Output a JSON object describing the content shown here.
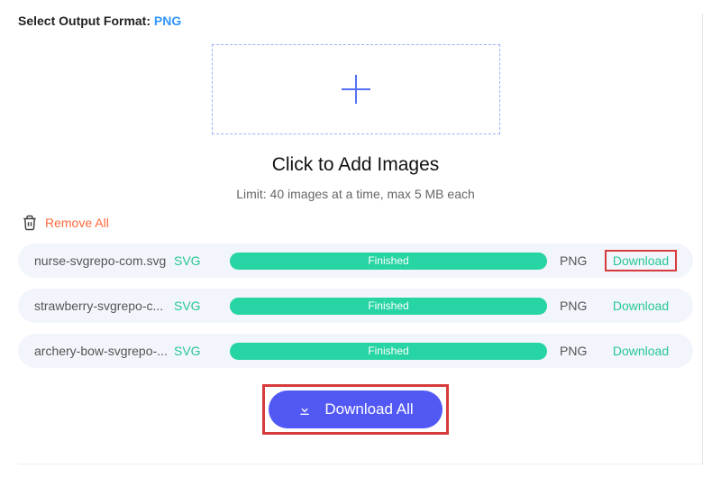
{
  "header": {
    "format_label": "Select Output Format: ",
    "format_value": "PNG"
  },
  "upload": {
    "title": "Click to Add Images",
    "limit": "Limit: 40 images at a time, max 5 MB each"
  },
  "actions": {
    "remove_all": "Remove All",
    "download_all": "Download All"
  },
  "files": [
    {
      "name": "nurse-svgrepo-com.svg",
      "src": "SVG",
      "status": "Finished",
      "dst": "PNG",
      "download": "Download",
      "highlight": true
    },
    {
      "name": "strawberry-svgrepo-c...",
      "src": "SVG",
      "status": "Finished",
      "dst": "PNG",
      "download": "Download",
      "highlight": false
    },
    {
      "name": "archery-bow-svgrepo-...",
      "src": "SVG",
      "status": "Finished",
      "dst": "PNG",
      "download": "Download",
      "highlight": false
    }
  ],
  "colors": {
    "accent_blue": "#5158f4",
    "accent_green": "#27c796",
    "highlight_red": "#d63c3c",
    "link_blue": "#3296ff",
    "remove_orange": "#ff6a3d"
  }
}
